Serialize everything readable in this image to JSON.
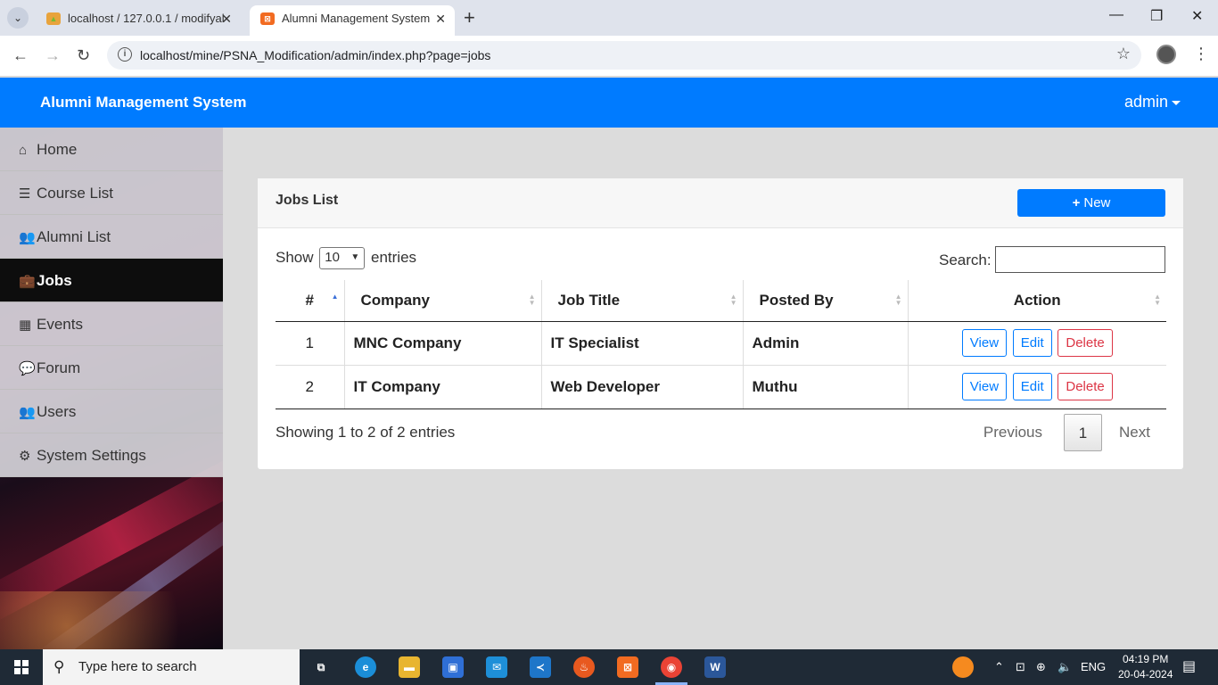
{
  "browser": {
    "tabs": [
      {
        "label": "localhost / 127.0.0.1 / modifyal",
        "favicon": "pma-icon"
      },
      {
        "label": "Alumni Management System",
        "favicon": "xampp-icon"
      }
    ],
    "url": "localhost/mine/PSNA_Modification/admin/index.php?page=jobs"
  },
  "header": {
    "title": "Alumni Management System",
    "user": "admin"
  },
  "sidebar": {
    "items": [
      {
        "label": "Home",
        "icon": "home-icon"
      },
      {
        "label": "Course List",
        "icon": "list-icon"
      },
      {
        "label": "Alumni List",
        "icon": "users-icon"
      },
      {
        "label": "Jobs",
        "icon": "briefcase-icon",
        "active": true
      },
      {
        "label": "Events",
        "icon": "calendar-icon"
      },
      {
        "label": "Forum",
        "icon": "comments-icon"
      },
      {
        "label": "Users",
        "icon": "users-icon"
      },
      {
        "label": "System Settings",
        "icon": "cogs-icon"
      }
    ]
  },
  "card": {
    "title": "Jobs List",
    "new_button": "New"
  },
  "table_controls": {
    "show": "Show",
    "entries_value": "10",
    "entries": "entries",
    "search_label": "Search:",
    "search_value": ""
  },
  "table": {
    "columns": [
      "#",
      "Company",
      "Job Title",
      "Posted By",
      "Action"
    ],
    "rows": [
      {
        "num": "1",
        "company": "MNC Company",
        "job_title": "IT Specialist",
        "posted_by": "Admin"
      },
      {
        "num": "2",
        "company": "IT Company",
        "job_title": "Web Developer",
        "posted_by": "Muthu"
      }
    ],
    "actions": {
      "view": "View",
      "edit": "Edit",
      "delete": "Delete"
    }
  },
  "footer": {
    "info": "Showing 1 to 2 of 2 entries",
    "previous": "Previous",
    "page": "1",
    "next": "Next"
  },
  "taskbar": {
    "search_placeholder": "Type here to search",
    "language": "ENG",
    "time": "04:19 PM",
    "date": "20-04-2024"
  },
  "colors": {
    "primary": "#007bff",
    "danger": "#dc3545",
    "sidebar_active": "#0d0d0d"
  }
}
